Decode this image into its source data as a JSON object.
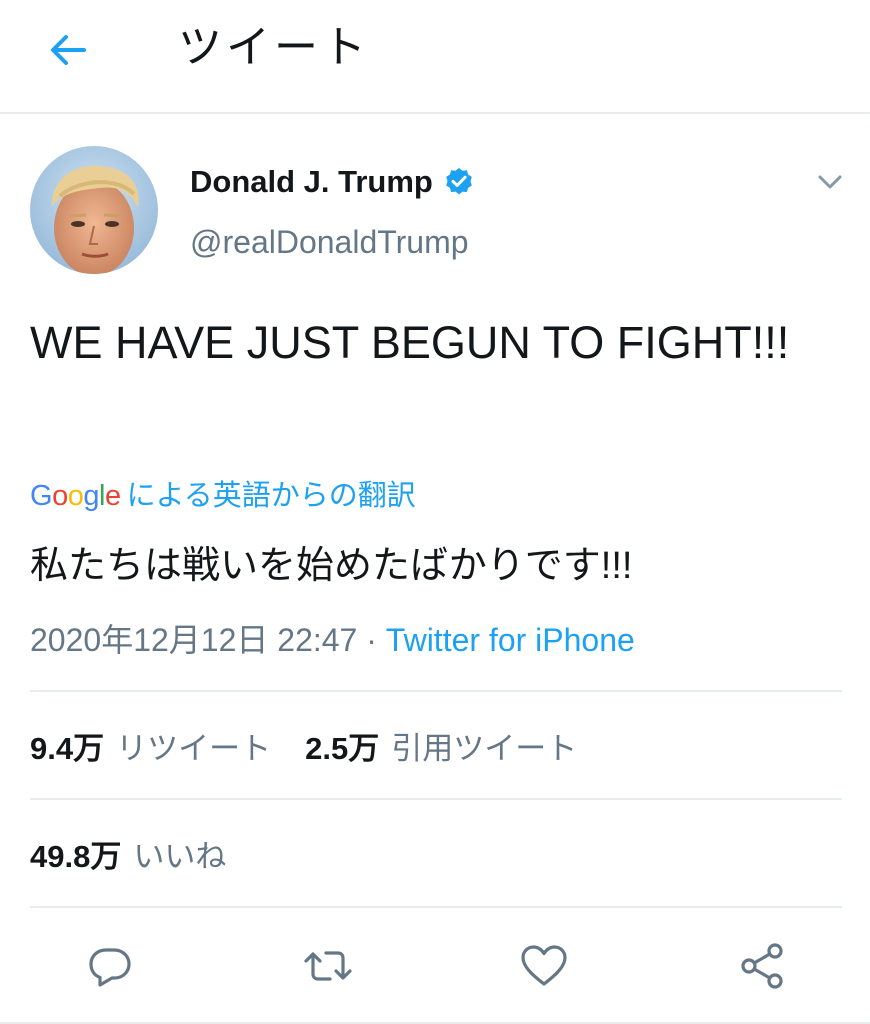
{
  "header": {
    "back_icon": "arrow-left-icon",
    "title": "ツイート"
  },
  "tweet": {
    "author": {
      "display_name": "Donald J. Trump",
      "handle": "@realDonaldTrump",
      "verified": true,
      "avatar_icon": "profile-photo"
    },
    "menu_icon": "chevron-down-icon",
    "text": "WE HAVE JUST BEGUN TO FIGHT!!!",
    "translation": {
      "provider": "Google",
      "label": "による英語からの翻訳",
      "text": "私たちは戦いを始めたばかりです!!!"
    },
    "timestamp": "2020年12月12日 22:47",
    "separator": " · ",
    "source": "Twitter for iPhone"
  },
  "stats": {
    "retweets_count": "9.4万",
    "retweets_label": "リツイート",
    "quotes_count": "2.5万",
    "quotes_label": "引用ツイート",
    "likes_count": "49.8万",
    "likes_label": "いいね"
  },
  "actions": [
    {
      "icon": "reply-icon"
    },
    {
      "icon": "retweet-icon"
    },
    {
      "icon": "heart-icon"
    },
    {
      "icon": "share-icon"
    }
  ],
  "colors": {
    "accent": "#1da1f2",
    "text_primary": "#14171a",
    "text_secondary": "#657786",
    "divider": "#e6ecf0",
    "icon_gray": "#657786"
  }
}
